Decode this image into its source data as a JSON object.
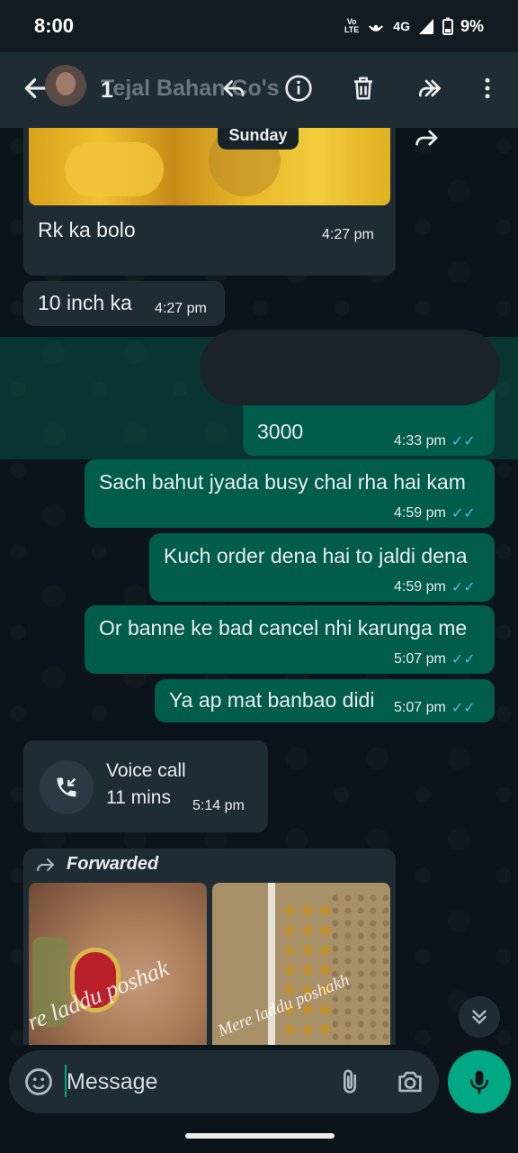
{
  "status_bar": {
    "time": "8:00",
    "volte_line1": "Vo",
    "volte_line2": "LTE",
    "network": "4G",
    "battery": "9%"
  },
  "app_bar": {
    "contact_name": "Tejal Bahan Co's",
    "selected_count": "1",
    "icons": [
      "back-arrow-icon",
      "reply-icon",
      "info-icon",
      "delete-icon",
      "forward-icon",
      "more-options-icon"
    ]
  },
  "chat": {
    "date_chip": "Sunday",
    "messages": [
      {
        "dir": "in",
        "text": "Rk ka bolo",
        "time": "4:27 pm"
      },
      {
        "dir": "in",
        "text": "10 inch ka",
        "time": "4:27 pm"
      },
      {
        "dir": "out",
        "text": "3000",
        "time": "4:33 pm"
      },
      {
        "dir": "out",
        "text": "Sach bahut jyada busy chal rha hai kam",
        "time": "4:59 pm"
      },
      {
        "dir": "out",
        "text": "Kuch order dena hai to jaldi dena",
        "time": "4:59 pm"
      },
      {
        "dir": "out",
        "text": "Or banne ke bad cancel nhi karunga me",
        "time": "5:07 pm"
      },
      {
        "dir": "out",
        "text": "Ya ap mat banbao didi",
        "time": "5:07 pm"
      }
    ],
    "voice_call": {
      "title": "Voice call",
      "duration": "11 mins",
      "time": "5:14 pm"
    },
    "forwarded": {
      "label": "Forwarded",
      "watermark_1": "re laddu poshak",
      "watermark_2": "Mere laddu poshakh"
    },
    "read_ticks": "✓✓"
  },
  "input_bar": {
    "placeholder": "Message"
  },
  "colors": {
    "background": "#0b141a",
    "incoming": "#202c33",
    "outgoing": "#005c4b",
    "accent": "#00a884",
    "read_tick": "#53bdeb"
  }
}
